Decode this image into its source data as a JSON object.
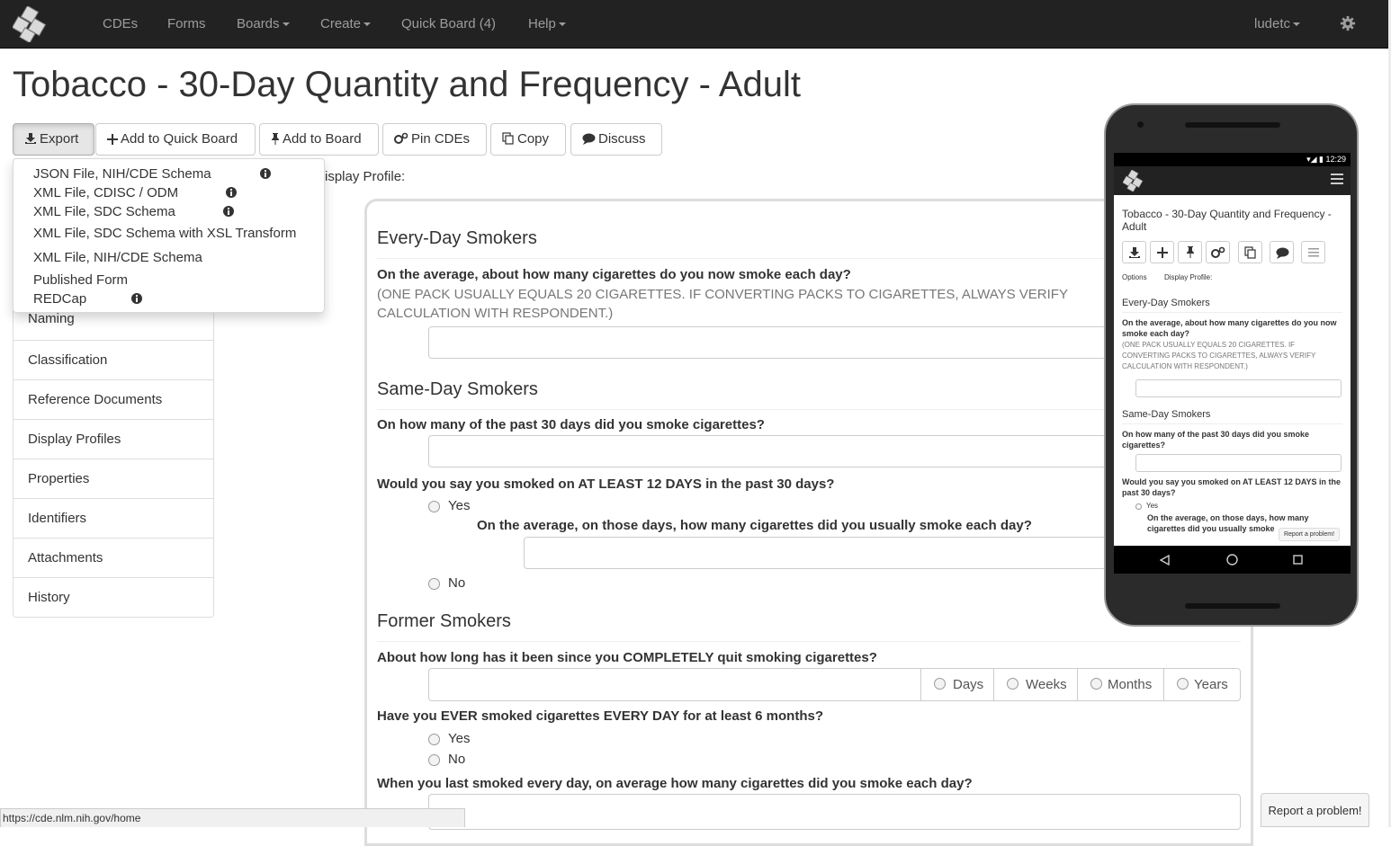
{
  "navbar": {
    "items": [
      {
        "label": "CDEs",
        "dropdown": false
      },
      {
        "label": "Forms",
        "dropdown": false
      },
      {
        "label": "Boards",
        "dropdown": true
      },
      {
        "label": "Create",
        "dropdown": true
      },
      {
        "label": "Quick Board (4)",
        "dropdown": false
      },
      {
        "label": "Help",
        "dropdown": true
      }
    ],
    "user": "ludetc"
  },
  "page": {
    "title": "Tobacco - 30-Day Quantity and Frequency - Adult"
  },
  "toolbar": {
    "export": "Export",
    "add_quick_board": "Add to Quick Board",
    "add_board": "Add to Board",
    "pin_cdes": "Pin CDEs",
    "copy": "Copy",
    "discuss": "Discuss"
  },
  "export_menu": {
    "items": [
      "JSON File, NIH/CDE Schema",
      "XML File, CDISC / ODM",
      "XML File, SDC Schema",
      "XML File, SDC Schema with XSL Transform",
      "XML File, NIH/CDE Schema",
      "Published Form",
      "REDCap"
    ]
  },
  "display_profile_label": "isplay Profile:",
  "sidebar": {
    "items": [
      "Naming",
      "Classification",
      "Reference Documents",
      "Display Profiles",
      "Properties",
      "Identifiers",
      "Attachments",
      "History"
    ]
  },
  "form": {
    "sections": {
      "everyday": "Every-Day Smokers",
      "sameday": "Same-Day Smokers",
      "former": "Former Smokers"
    },
    "q1": "On the average, about how many cigarettes do you now smoke each day?",
    "q1_note": "(ONE PACK USUALLY EQUALS 20 CIGARETTES. IF CONVERTING PACKS TO CIGARETTES, ALWAYS VERIFY CALCULATION WITH RESPONDENT.)",
    "q2": "On how many of the past 30 days did you smoke cigarettes?",
    "q3": "Would you say you smoked on AT LEAST 12 DAYS in the past 30 days?",
    "q3_sub": "On the average, on those days, how many cigarettes did you usually smoke each day?",
    "yes": "Yes",
    "no": "No",
    "q4": "About how long has it been since you COMPLETELY quit smoking cigarettes?",
    "units": [
      "Days",
      "Weeks",
      "Months",
      "Years"
    ],
    "q5": "Have you EVER smoked cigarettes EVERY DAY for at least 6 months?",
    "q6": "When you last smoked every day, on average how many cigarettes did you smoke each day?"
  },
  "phone": {
    "time": "12:29",
    "title": "Tobacco - 30-Day Quantity and Frequency - Adult",
    "options": "Options",
    "display_profile": "Display Profile:",
    "everyday": "Every-Day Smokers",
    "q1": "On the average, about how many cigarettes do you now smoke each day?",
    "q1_note": "(ONE PACK USUALLY EQUALS 20 CIGARETTES. IF CONVERTING PACKS TO CIGARETTES, ALWAYS VERIFY CALCULATION WITH RESPONDENT.)",
    "sameday": "Same-Day Smokers",
    "q2": "On how many of the past 30 days did you smoke cigarettes?",
    "q3": "Would you say you smoked on AT LEAST 12 DAYS in the past 30 days?",
    "yes": "Yes",
    "q3_sub": "On the average, on those days, how many cigarettes did you usually smoke",
    "report": "Report a problem!"
  },
  "status_url": "https://cde.nlm.nih.gov/home",
  "report_problem": "Report a problem!"
}
